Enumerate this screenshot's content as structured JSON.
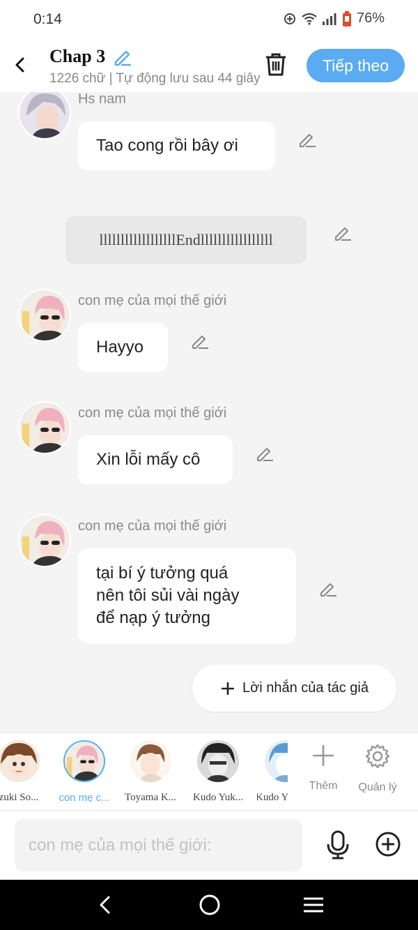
{
  "status": {
    "time": "0:14",
    "battery": "76%"
  },
  "header": {
    "title": "Chap 3",
    "subtitle": "1226 chữ | Tự động lưu sau 44 giây",
    "next_label": "Tiếp theo"
  },
  "messages": [
    {
      "sender": "Hs nam",
      "text": "Tao cong rồi bây ơi"
    },
    {
      "divider": "llllllllllllllllllEndlllllllllllllllll"
    },
    {
      "sender": "con mẹ của mọi thế giới",
      "text": "Hayyo"
    },
    {
      "sender": "con mẹ của mọi thế giới",
      "text": "Xin lỗi mấy cô"
    },
    {
      "sender": "con mẹ của mọi thế giới",
      "lines": [
        "tại bí ý tưởng quá",
        "nên tôi sủi vài ngày",
        "để nạp ý tưởng"
      ]
    }
  ],
  "author_note_label": "Lời nhắn của tác giả",
  "characters": [
    {
      "name": "zuki So..."
    },
    {
      "name": "con mẹ c..."
    },
    {
      "name": "Toyama K..."
    },
    {
      "name": "Kudo Yuk..."
    },
    {
      "name": "Kudo Y"
    }
  ],
  "strip_actions": {
    "add_label": "Thêm",
    "manage_label": "Quản lý"
  },
  "input": {
    "placeholder": "con mẹ của mọi thế giới:"
  },
  "colors": {
    "accent": "#5aabf1",
    "bubble": "#ffffff",
    "background": "#f4f4f4"
  },
  "icons": [
    "back-icon",
    "pencil-icon",
    "trash-icon",
    "plus-icon",
    "gear-icon",
    "mic-icon",
    "plus-circle-icon"
  ]
}
